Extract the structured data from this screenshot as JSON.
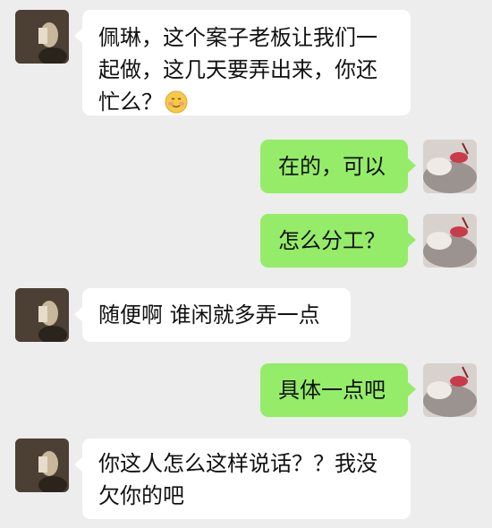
{
  "messages": [
    {
      "side": "left",
      "text": "佩琳，这个案子老板让我们一起做，这几天要弄出来，你还忙么？",
      "emoji": "smiling-face-emoji"
    },
    {
      "side": "right",
      "text": "在的，可以"
    },
    {
      "side": "right",
      "text": "怎么分工？"
    },
    {
      "side": "left",
      "text": "随便啊 谁闲就多弄一点"
    },
    {
      "side": "right",
      "text": "具体一点吧"
    },
    {
      "side": "left",
      "text": "你这人怎么这样说话？？我没欠你的吧"
    }
  ],
  "colors": {
    "background": "#ededed",
    "incoming_bubble": "#ffffff",
    "outgoing_bubble": "#95ec69"
  }
}
